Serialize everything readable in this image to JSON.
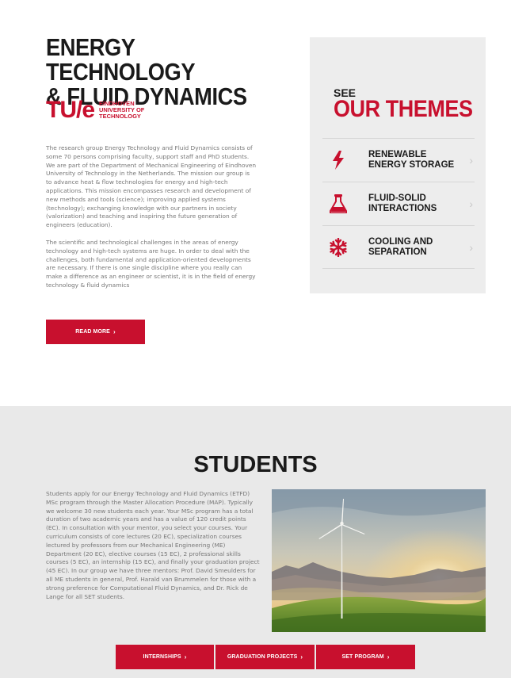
{
  "intro": {
    "title_line1": "ENERGY TECHNOLOGY",
    "title_line2": "& FLUID DYNAMICS",
    "logo": {
      "mark": "TU/e",
      "line1": "EINDHOVEN",
      "line2": "UNIVERSITY OF",
      "line3": "TECHNOLOGY"
    },
    "paragraph1": "The research group Energy Technology and Fluid Dynamics consists of some 70 persons comprising faculty, support staff and PhD students. We are part of the Department of Mechanical Engineering of Eindhoven University of Technology in the Netherlands. The mission our group is to advance heat & flow technologies for energy and high-tech applications. This mission encompasses research and development of new methods and tools (science); improving applied systems (technology); exchanging knowledge with our partners in society (valorization) and teaching and inspiring the future generation of engineers (education).",
    "paragraph2": "The scientific and technological challenges in the areas of energy technology and high-tech systems are huge. In order to deal with the challenges, both fundamental and application-oriented developments are necessary. If there is one single discipline where you really can make a difference as an engineer or scientist, it is in the field of energy technology & fluid dynamics",
    "read_more_label": "READ MORE",
    "chevron": "›"
  },
  "themes": {
    "see_label": "SEE",
    "heading": "OUR THEMES",
    "items": [
      {
        "label": "RENEWABLE ENERGY STORAGE",
        "icon": "lightning-icon"
      },
      {
        "label": "FLUID-SOLID INTERACTIONS",
        "icon": "flask-icon"
      },
      {
        "label": "COOLING AND SEPARATION",
        "icon": "snowflake-icon"
      }
    ],
    "chevron": "›"
  },
  "students": {
    "title": "STUDENTS",
    "paragraph": "Students apply for our Energy Technology and Fluid Dynamics (ETFD) MSc program through the Master Allocation Procedure (MAP). Typically we welcome 30 new students each year. Your MSc program has a total duration of two academic years and has a value of 120 credit points (EC). In consultation with your mentor, you select your courses. Your curriculum consists of core lectures (20 EC), specialization courses lectured by professors from our Mechanical Engineering (ME) Department (20 EC), elective courses (15 EC), 2 professional skills courses (5 EC), an internship (15 EC), and finally your graduation project (45 EC). In our group we have three mentors: Prof. David Smeulders for all ME students in general, Prof. Harald van Brummelen for those with a strong preference for Computational Fluid Dynamics, and Dr. Rick de Lange for all SET students.",
    "buttons": {
      "internships": "INTERNSHIPS",
      "graduation": "GRADUATION PROJECTS",
      "set_program": "SET PROGRAM"
    },
    "chevron": "›"
  },
  "colors": {
    "accent": "#c8102e",
    "panel": "#ededed",
    "section_bg": "#e9e9e9"
  }
}
